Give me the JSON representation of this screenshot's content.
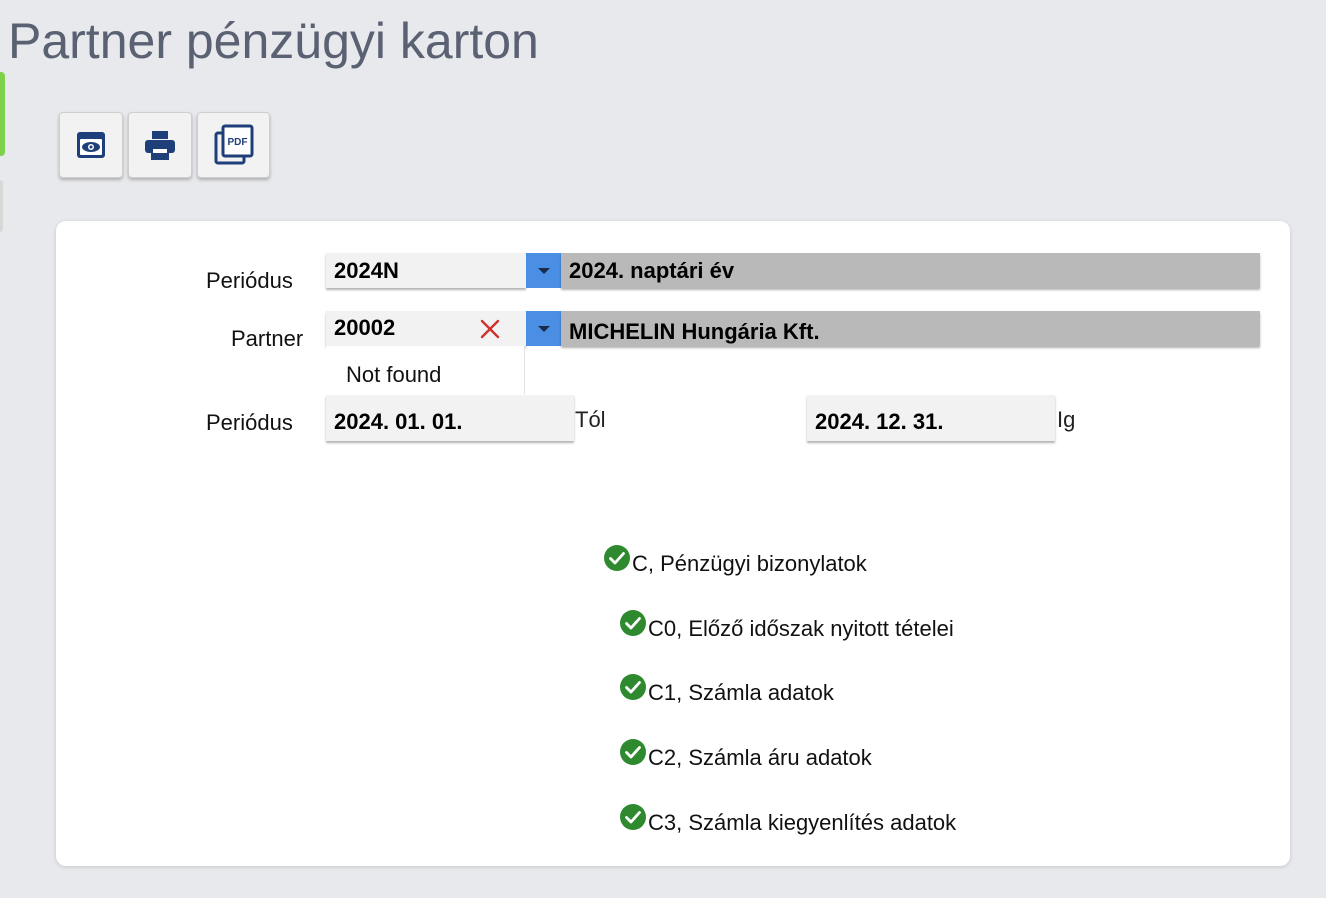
{
  "page": {
    "title": "Partner pénzügyi karton"
  },
  "toolbar": {
    "buttons": [
      {
        "name": "preview",
        "icon": "eye-icon"
      },
      {
        "name": "print",
        "icon": "printer-icon"
      },
      {
        "name": "pdf",
        "icon": "pdf-icon",
        "label": "PDF"
      }
    ]
  },
  "form": {
    "period": {
      "label": "Periódus",
      "value": "2024N",
      "description": "2024. naptári év"
    },
    "partner": {
      "label": "Partner",
      "value": "20002",
      "description": "MICHELIN Hungária Kft.",
      "dropdown_item": "Not found"
    },
    "date_range": {
      "label": "Periódus",
      "from": "2024. 01. 01.",
      "from_suffix": "Tól",
      "to": "2024. 12. 31.",
      "to_suffix": "Ig"
    }
  },
  "checklist": [
    {
      "label": "C, Pénzügyi bizonylatok",
      "checked": true
    },
    {
      "label": "C0, Előző időszak nyitott tételei",
      "checked": true
    },
    {
      "label": "C1, Számla adatok",
      "checked": true
    },
    {
      "label": "C2, Számla áru adatok",
      "checked": true
    },
    {
      "label": "C3, Számla kiegyenlítés adatok",
      "checked": true
    }
  ],
  "colors": {
    "accent": "#4a8fe3",
    "check": "#2f8a2f",
    "clear": "#d0312d",
    "background": "#e8e9ec"
  }
}
